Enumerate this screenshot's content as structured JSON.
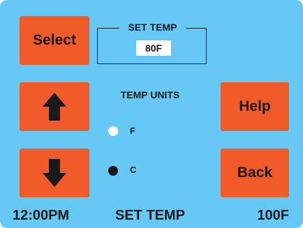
{
  "buttons": {
    "select_label": "Select",
    "help_label": "Help",
    "back_label": "Back"
  },
  "icons": {
    "up": "arrow-up-icon",
    "down": "arrow-down-icon"
  },
  "set_temp": {
    "title": "SET TEMP",
    "value": "80F"
  },
  "temp_units": {
    "title": "TEMP UNITS",
    "options": [
      {
        "label": "F",
        "selected": false
      },
      {
        "label": "C",
        "selected": true
      }
    ]
  },
  "status_bar": {
    "time": "12:00PM",
    "mode": "SET TEMP",
    "temperature": "100F"
  },
  "colors": {
    "background": "#66c9f5",
    "button": "#f15a29",
    "text": "#1a1a1a"
  }
}
